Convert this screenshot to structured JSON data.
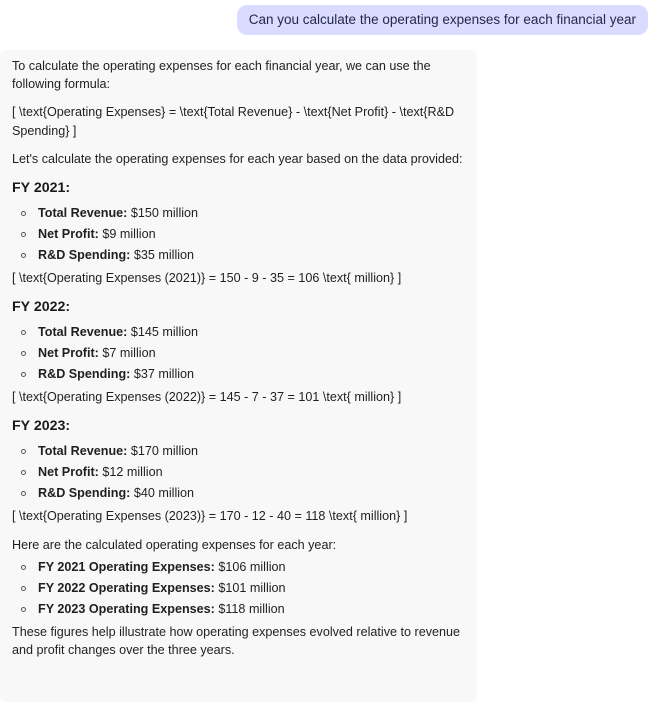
{
  "user_message": "Can you calculate the operating expenses for each financial year",
  "response": {
    "intro": "To calculate the operating expenses for each financial year, we can use the following formula:",
    "formula": "[ \\text{Operating Expenses} = \\text{Total Revenue} - \\text{Net Profit} - \\text{R&D Spending} ]",
    "lead_in": "Let's calculate the operating expenses for each year based on the data provided:",
    "years": [
      {
        "heading": "FY 2021:",
        "items": [
          {
            "label": "Total Revenue:",
            "value": " $150 million"
          },
          {
            "label": "Net Profit:",
            "value": " $9 million"
          },
          {
            "label": "R&D Spending:",
            "value": " $35 million"
          }
        ],
        "calc": "[ \\text{Operating Expenses (2021)} = 150 - 9 - 35 = 106 \\text{ million} ]"
      },
      {
        "heading": "FY 2022:",
        "items": [
          {
            "label": "Total Revenue:",
            "value": " $145 million"
          },
          {
            "label": "Net Profit:",
            "value": " $7 million"
          },
          {
            "label": "R&D Spending:",
            "value": " $37 million"
          }
        ],
        "calc": "[ \\text{Operating Expenses (2022)} = 145 - 7 - 37 = 101 \\text{ million} ]"
      },
      {
        "heading": "FY 2023:",
        "items": [
          {
            "label": "Total Revenue:",
            "value": " $170 million"
          },
          {
            "label": "Net Profit:",
            "value": " $12 million"
          },
          {
            "label": "R&D Spending:",
            "value": " $40 million"
          }
        ],
        "calc": "[ \\text{Operating Expenses (2023)} = 170 - 12 - 40 = 118 \\text{ million} ]"
      }
    ],
    "summary_intro": "Here are the calculated operating expenses for each year:",
    "summary": [
      {
        "label": "FY 2021 Operating Expenses:",
        "value": " $106 million"
      },
      {
        "label": "FY 2022 Operating Expenses:",
        "value": " $101 million"
      },
      {
        "label": "FY 2023 Operating Expenses:",
        "value": " $118 million"
      }
    ],
    "closing": "These figures help illustrate how operating expenses evolved relative to revenue and profit changes over the three years."
  }
}
